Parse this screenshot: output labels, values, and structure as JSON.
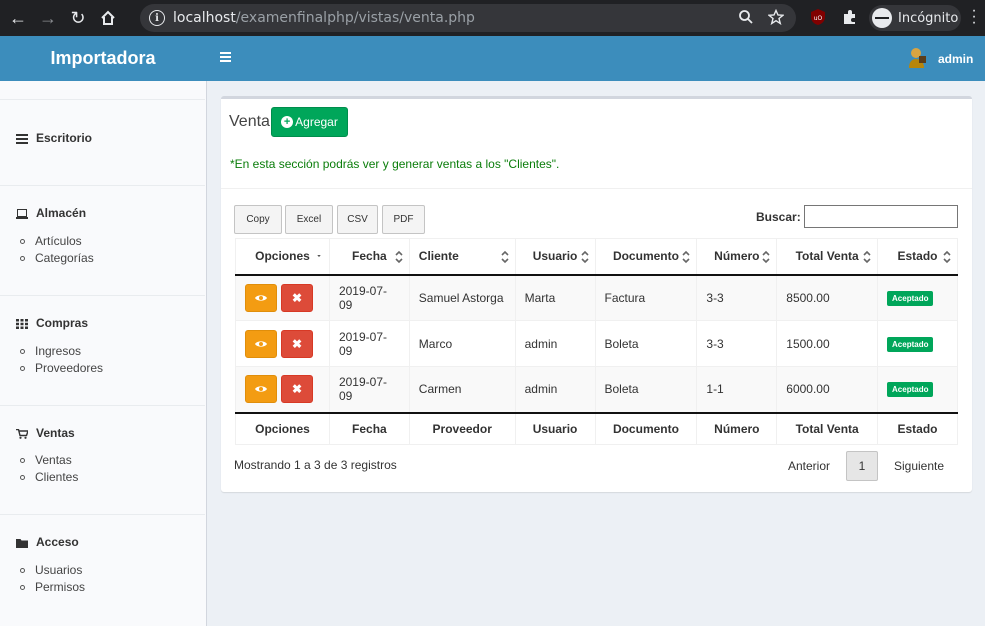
{
  "browser": {
    "url_host": "localhost",
    "url_path": "/examenfinalphp/vistas/venta.php",
    "incognito_label": "Incógnito"
  },
  "header": {
    "brand": "Importadora",
    "user": "admin"
  },
  "sidebar": {
    "sections": [
      {
        "label": "Escritorio",
        "icon": "dashboard-icon",
        "items": []
      },
      {
        "label": "Almacén",
        "icon": "laptop-icon",
        "items": [
          "Artículos",
          "Categorías"
        ]
      },
      {
        "label": "Compras",
        "icon": "grid-icon",
        "items": [
          "Ingresos",
          "Proveedores"
        ]
      },
      {
        "label": "Ventas",
        "icon": "cart-icon",
        "items": [
          "Ventas",
          "Clientes"
        ]
      },
      {
        "label": "Acceso",
        "icon": "folder-icon",
        "items": [
          "Usuarios",
          "Permisos"
        ]
      }
    ]
  },
  "main": {
    "title": "Venta",
    "add_button": "Agregar",
    "note": "*En esta sección podrás ver y generar ventas a los \"Clientes\".",
    "export_buttons": [
      "Copy",
      "Excel",
      "CSV",
      "PDF"
    ],
    "search_label": "Buscar:",
    "search_value": "",
    "table": {
      "columns": [
        "Opciones",
        "Fecha",
        "Cliente",
        "Usuario",
        "Documento",
        "Número",
        "Total Venta",
        "Estado"
      ],
      "footer_columns": [
        "Opciones",
        "Fecha",
        "Proveedor",
        "Usuario",
        "Documento",
        "Número",
        "Total Venta",
        "Estado"
      ],
      "rows": [
        {
          "fecha": "2019-07-09",
          "cliente": "Samuel Astorga",
          "usuario": "Marta",
          "documento": "Factura",
          "numero": "3-3",
          "total": "8500.00",
          "estado": "Aceptado"
        },
        {
          "fecha": "2019-07-09",
          "cliente": "Marco",
          "usuario": "admin",
          "documento": "Boleta",
          "numero": "3-3",
          "total": "1500.00",
          "estado": "Aceptado"
        },
        {
          "fecha": "2019-07-09",
          "cliente": "Carmen",
          "usuario": "admin",
          "documento": "Boleta",
          "numero": "1-1",
          "total": "6000.00",
          "estado": "Aceptado"
        }
      ]
    },
    "info": "Mostrando 1 a 3 de 3 registros",
    "pagination": {
      "prev": "Anterior",
      "current": "1",
      "next": "Siguiente"
    }
  },
  "colors": {
    "header": "#3c8dbc",
    "add_button": "#00a65a",
    "view_button": "#f39c12",
    "delete_button": "#dd4b39",
    "badge": "#00a65a"
  }
}
